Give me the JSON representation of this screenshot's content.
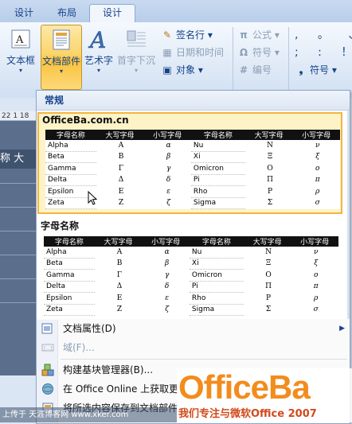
{
  "tabs": [
    {
      "label": "设计"
    },
    {
      "label": "布局"
    },
    {
      "label": "设计"
    }
  ],
  "ribbon": {
    "text_box": "文本框",
    "quick_parts": "文档部件",
    "wordart": "艺术字",
    "drop_cap": "首字下沉",
    "signature_line": "签名行",
    "date_time": "日期和时间",
    "object": "对象",
    "equation": "公式",
    "symbol_disabled": "符号",
    "numbering": "编号",
    "symbol": "符号",
    "pi_glyph": "π",
    "omega_glyph": "Ω",
    "hash_glyph": "#"
  },
  "document": {
    "ruler_text": "22 1 18",
    "bar_text": "称  大"
  },
  "gallery": {
    "header": "常规",
    "blocks": [
      {
        "title": "OfficeBa.com.cn"
      },
      {
        "title": "字母名称"
      }
    ],
    "columns": [
      "字母名称",
      "大写字母",
      "小写字母",
      "字母名称",
      "大写字母",
      "小写字母"
    ],
    "rows": [
      [
        "Alpha",
        "Α",
        "α",
        "Nu",
        "Ν",
        "ν"
      ],
      [
        "Beta",
        "Β",
        "β",
        "Xi",
        "Ξ",
        "ξ"
      ],
      [
        "Gamma",
        "Γ",
        "γ",
        "Omicron",
        "Ο",
        "ο"
      ],
      [
        "Delta",
        "Δ",
        "δ",
        "Pi",
        "Π",
        "π"
      ],
      [
        "Epsilon",
        "Ε",
        "ε",
        "Rho",
        "Ρ",
        "ρ"
      ],
      [
        "Zeta",
        "Ζ",
        "ζ",
        "Sigma",
        "Σ",
        "σ"
      ]
    ]
  },
  "menu_items": {
    "doc_property": "文档属性(D)",
    "field": "域(F)...",
    "building_blocks": "构建基块管理器(B)...",
    "get_more": "在 Office Online 上获取更",
    "save_selection": "将所选内容保存到文档部件"
  },
  "watermark": {
    "logo": "OfficeBa",
    "tagline": "我们专注与微软Office 2007",
    "site": "上传于 天涯博客网 www.xker.com"
  },
  "colors": {
    "ribbon_text": "#15428b",
    "highlight": "#f9c23b",
    "logo_orange": "#f28c1d"
  }
}
